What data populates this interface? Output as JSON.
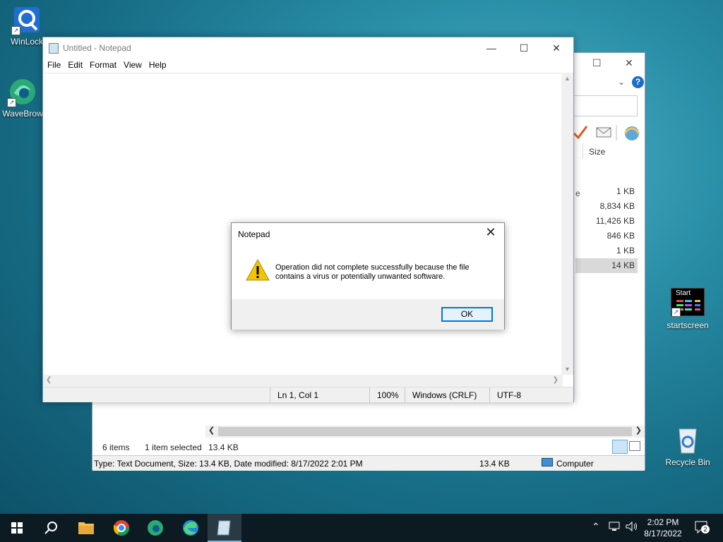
{
  "desktop": {
    "icons": [
      {
        "label": "WinLock"
      },
      {
        "label": "WaveBrow"
      },
      {
        "label": "startscreen",
        "tile_text": "Start"
      },
      {
        "label": "Recycle Bin"
      }
    ]
  },
  "explorer": {
    "column_header": "Size",
    "sizes": [
      "1 KB",
      "8,834 KB",
      "11,426 KB",
      "846 KB",
      "1 KB",
      "14 KB"
    ],
    "selected_index": 5,
    "status_items": "6 items",
    "status_selected": "1 item selected",
    "status_selected_size": "13.4 KB",
    "details_text": "Type: Text Document, Size: 13.4 KB, Date modified: 8/17/2022 2:01 PM",
    "details_size": "13.4 KB",
    "details_location": "Computer",
    "help_glyph": "?"
  },
  "notepad": {
    "title": "Untitled - Notepad",
    "menu": [
      "File",
      "Edit",
      "Format",
      "View",
      "Help"
    ],
    "status": {
      "position": "Ln 1, Col 1",
      "zoom": "100%",
      "line_ending": "Windows (CRLF)",
      "encoding": "UTF-8"
    }
  },
  "dialog": {
    "title": "Notepad",
    "message": "Operation did not complete successfully because the file contains a virus or potentially unwanted software.",
    "ok_label": "OK"
  },
  "taskbar": {
    "time": "2:02 PM",
    "date": "8/17/2022",
    "notification_count": "2"
  },
  "colors": {
    "accent": "#0078d7",
    "taskbar": "#0c1a22",
    "warning": "#f5c400"
  }
}
